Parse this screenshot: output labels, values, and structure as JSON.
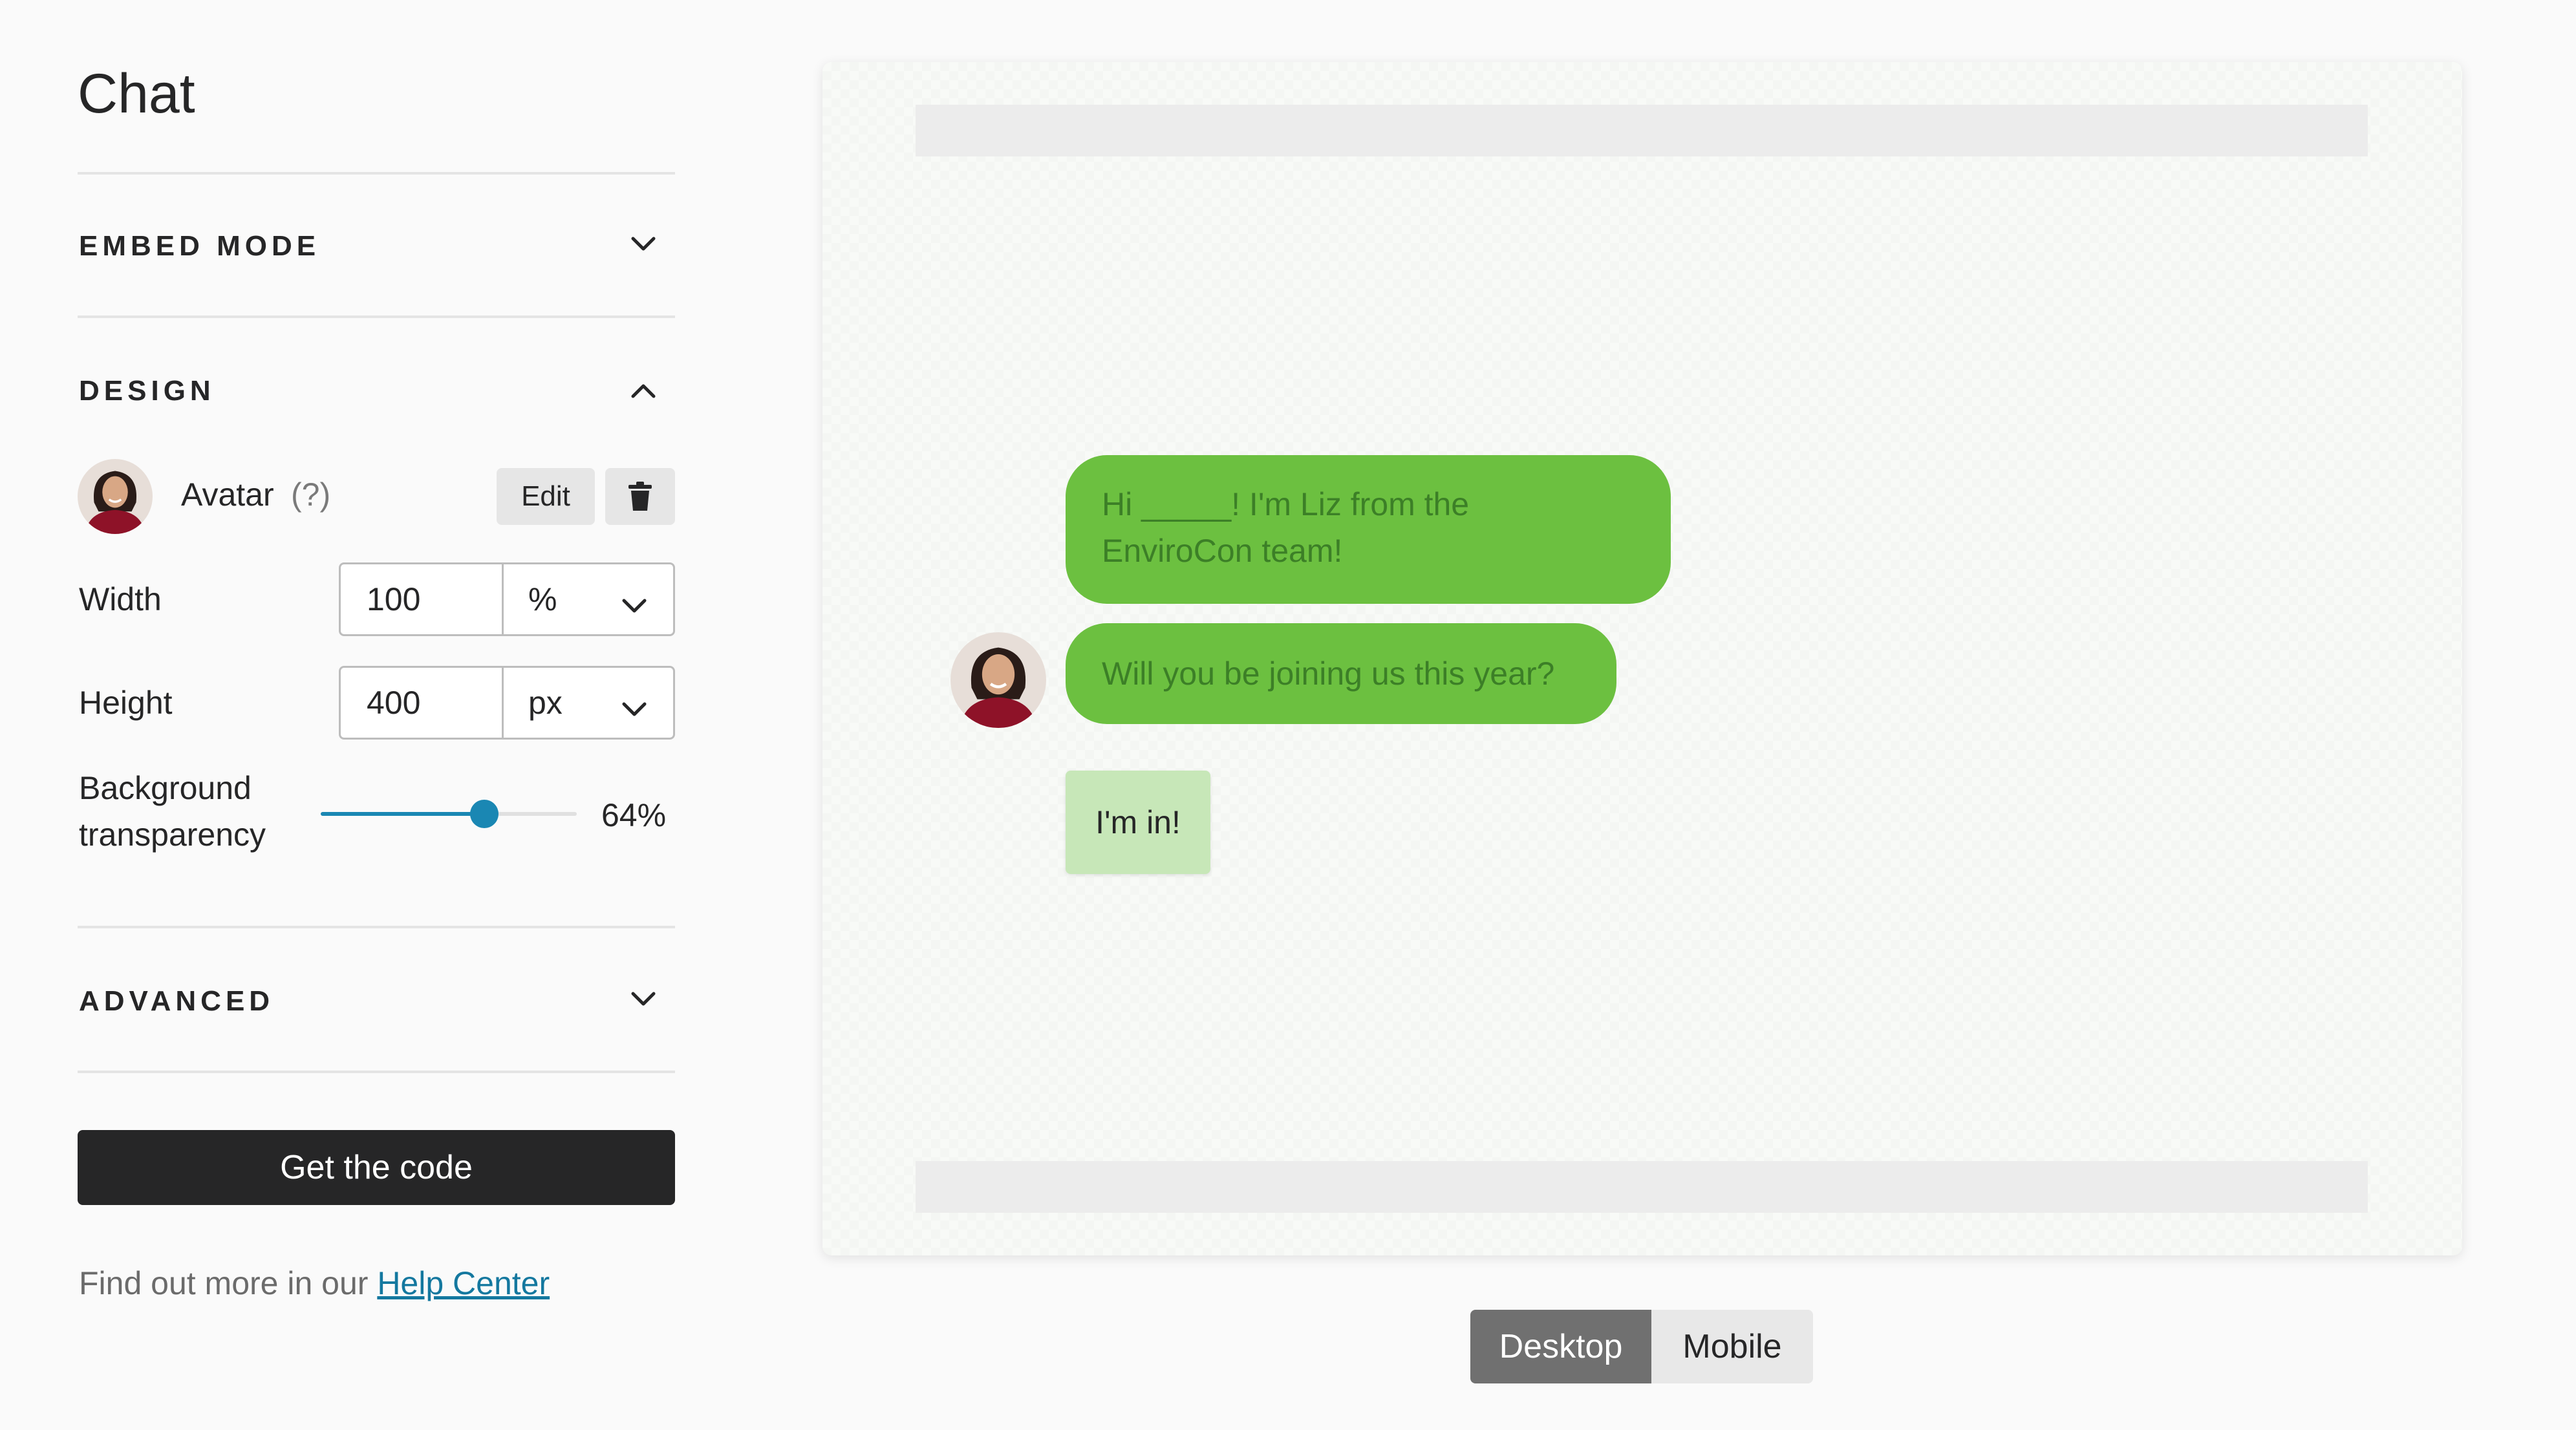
{
  "panel": {
    "title": "Chat",
    "sections": {
      "embed_mode": "EMBED MODE",
      "design": "DESIGN",
      "advanced": "ADVANCED"
    },
    "avatar": {
      "label": "Avatar",
      "help": "(?)",
      "edit_label": "Edit"
    },
    "width": {
      "label": "Width",
      "value": "100",
      "unit": "%"
    },
    "height": {
      "label": "Height",
      "value": "400",
      "unit": "px"
    },
    "transparency": {
      "label_line1": "Background",
      "label_line2": "transparency",
      "value_text": "64%",
      "value": 0.64
    },
    "cta_label": "Get the code",
    "help": {
      "prefix": "Find out more in our ",
      "link_text": "Help Center"
    }
  },
  "preview": {
    "messages": [
      {
        "line1": "Hi _____! I'm Liz from the",
        "line2": "EnviroCon team!"
      },
      {
        "line1": "Will you be joining us this year?"
      }
    ],
    "reply": "I'm in!"
  },
  "devices": {
    "desktop": "Desktop",
    "mobile": "Mobile",
    "selected": "Desktop"
  },
  "colors": {
    "bubble": "#6cc040",
    "bubble_text": "#3c7f27",
    "reply": "#c7e7b8",
    "accent": "#1a87b3",
    "cta": "#262627"
  }
}
